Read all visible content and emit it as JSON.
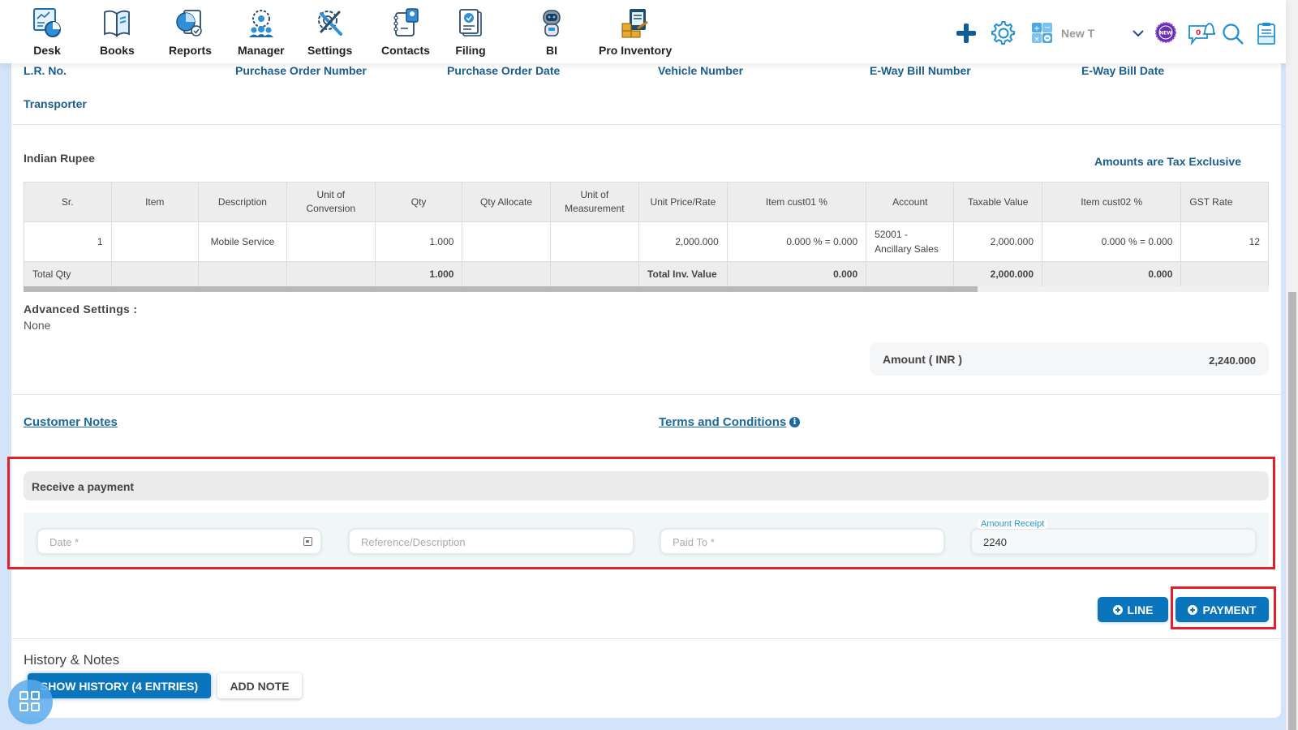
{
  "nav": {
    "items": [
      {
        "label": "Desk",
        "icon": "desk-icon"
      },
      {
        "label": "Books",
        "icon": "books-icon"
      },
      {
        "label": "Reports",
        "icon": "reports-icon"
      },
      {
        "label": "Manager",
        "icon": "manager-icon"
      },
      {
        "label": "Settings",
        "icon": "settings-tools-icon"
      },
      {
        "label": "Contacts",
        "icon": "contacts-icon"
      },
      {
        "label": "Filing",
        "icon": "filing-icon"
      },
      {
        "label": "BI",
        "icon": "bi-robot-icon"
      },
      {
        "label": "Pro Inventory",
        "icon": "pro-inventory-icon"
      }
    ],
    "tools": {
      "new_transaction_label": "New T",
      "notification_count": "0",
      "new_badge": "NEW"
    }
  },
  "shipping_fields": {
    "lr_no": "L.R. No.",
    "po_number": "Purchase Order Number",
    "po_date": "Purchase Order Date",
    "vehicle_number": "Vehicle Number",
    "eway_bill_number": "E-Way Bill Number",
    "eway_bill_date": "E-Way Bill Date",
    "transporter": "Transporter"
  },
  "currency": "Indian Rupee",
  "tax_note": "Amounts are Tax Exclusive",
  "table": {
    "headers": [
      "Sr.",
      "Item",
      "Description",
      "Unit of Conversion",
      "Qty",
      "Qty Allocate",
      "Unit of Measurement",
      "Unit Price/Rate",
      "Item cust01 %",
      "Account",
      "Taxable Value",
      "Item cust02 %",
      "GST Rate"
    ],
    "rows": [
      [
        "1",
        "",
        "Mobile Service",
        "",
        "1.000",
        "",
        "",
        "2,000.000",
        "0.000 % = 0.000",
        "52001 - Ancillary Sales",
        "2,000.000",
        "0.000 % = 0.000",
        "12"
      ]
    ],
    "totals": {
      "total_qty_label": "Total Qty",
      "total_qty": "1.000",
      "total_inv_label": "Total Inv. Value",
      "cust01_total": "0.000",
      "taxable_total": "2,000.000",
      "cust02_total": "0.000"
    }
  },
  "advanced_settings": {
    "label": "Advanced Settings :",
    "value": "None"
  },
  "amount": {
    "label": "Amount ( INR )",
    "value": "2,240.000"
  },
  "links": {
    "customer_notes": "Customer Notes",
    "terms": "Terms and Conditions"
  },
  "payment": {
    "title": "Receive a payment",
    "date_placeholder": "Date *",
    "reference_placeholder": "Reference/Description",
    "paid_to_placeholder": "Paid To *",
    "amount_label": "Amount Receipt",
    "amount_value": "2240"
  },
  "actions": {
    "line_label": "LINE",
    "payment_label": "PAYMENT"
  },
  "history": {
    "title": "History & Notes",
    "show_history_label": "SHOW HISTORY (4 ENTRIES)",
    "add_note_label": "ADD NOTE"
  },
  "colors": {
    "accent": "#0a74bd",
    "label_blue": "#1a5e8d",
    "highlight_red": "#e2202a"
  }
}
